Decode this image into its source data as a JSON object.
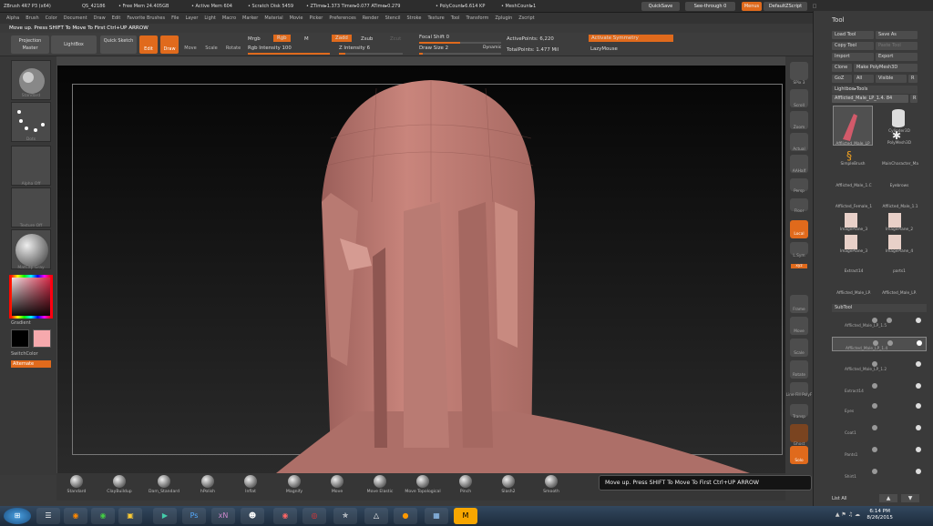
{
  "titlebar": {
    "app": "ZBrush 4R7 P3 (x64)",
    "qs": "QS_42186",
    "free_mem": "• Free Mem 24.405GB",
    "active_mem": "• Active Mem 604",
    "scratch": "• Scratch Disk 5459",
    "ztime": "• ZTime▸1.373 Timer▸0.077 ATime▸0.279",
    "polycount": "• PolyCount▸6.614 KP",
    "meshcount": "• MeshCount▸1",
    "quicksave": "QuickSave",
    "seethrough": "See-through 0",
    "menus": "Menus",
    "script": "DefaultZScript"
  },
  "menu": [
    "Alpha",
    "Brush",
    "Color",
    "Document",
    "Draw",
    "Edit",
    "Favorite Brushes",
    "File",
    "Layer",
    "Light",
    "Macro",
    "Marker",
    "Material",
    "Movie",
    "Picker",
    "Preferences",
    "Render",
    "Stencil",
    "Stroke",
    "Texture",
    "Tool",
    "Transform",
    "Zplugin",
    "Zscript"
  ],
  "hint": "Move up. Press SHIFT To Move To First Ctrl+UP ARROW",
  "shelf": {
    "projection": "Projection Master",
    "lightbox": "LightBox",
    "quicksketch": "Quick Sketch",
    "edit": "Edit",
    "draw": "Draw",
    "move": "Move",
    "scale": "Scale",
    "rotate": "Rotate",
    "mrgb": "Mrgb",
    "rgb": "Rgb",
    "m": "M",
    "zadd": "Zadd",
    "zsub": "Zsub",
    "zcut": "Zcut",
    "rgb_intensity": "Rgb Intensity 100",
    "z_intensity": "Z Intensity 6",
    "focal_shift": "Focal Shift 0",
    "draw_size": "Draw Size 2",
    "dynamic": "Dynamic",
    "active_points": "ActivePoints: 6,220",
    "total_points": "TotalPoints: 1.477 Mil",
    "activate_symmetry": "Activate Symmetry",
    "lazymouse": "LazyMouse"
  },
  "left": {
    "labels": [
      "Standard",
      "Dots",
      "Alpha Off",
      "Texture Off",
      "MatCap Gray"
    ],
    "gradient": "Gradient",
    "switchcolor": "SwitchColor",
    "alternate": "Alternate"
  },
  "right_strip": [
    "SPix 3",
    "Scroll",
    "Zoom",
    "Actual",
    "AAHalf",
    "Persp",
    "Floor",
    "Local",
    "L.Sym",
    "xyz",
    "Frame",
    "Move",
    "Scale",
    "Rotate",
    "Line Fill PolyF",
    "Transp",
    "Ghost",
    "Solo"
  ],
  "brushes": [
    "Standard",
    "ClayBuildup",
    "Dam_Standard",
    "hPolish",
    "Inflat",
    "Magnify",
    "Move",
    "Move Elastic",
    "Move Topological",
    "Pinch",
    "Slash2",
    "Smooth"
  ],
  "tooltip": "Move up. Press SHIFT To Move To First Ctrl+UP ARROW",
  "tool": {
    "title": "Tool",
    "buttons": [
      "Load Tool",
      "Save As",
      "Copy Tool",
      "Paste Tool",
      "Import",
      "Export",
      "Clone",
      "Make PolyMesh3D",
      "GoZ",
      "All",
      "Visible",
      "R"
    ],
    "lightbox_tools": "Lightbox▸Tools",
    "current": "Afflicted_Male_LP_1.4. 84",
    "current_r": "R",
    "grid": [
      "Afflicted_Male_LP",
      "Cylinder3D",
      "SimpleBrush",
      "PolyMesh3D",
      "MainCharacter_Ma",
      "Afflicted_Male_1.C",
      "Eyebrows",
      "Afflicted_Female_1",
      "Afflicted_Male_1.1",
      "ImagePlane_3",
      "ImagePlane_2",
      "ImagePlane_3",
      "ImagePlane_4",
      "Extract14",
      "parts1",
      "Afflicted_Male_LP.",
      "Afflicted_Male_LP."
    ],
    "subtool": "SubTool",
    "subtools": [
      "Afflicted_Male_LP_1.5",
      "Afflicted_Male_LP_1.4",
      "Afflicted_Male_LP_1.2",
      "Extract14",
      "Eyes",
      "Coat1",
      "Pants1",
      "Shirt1"
    ],
    "listall": "List All"
  },
  "clock": {
    "time": "6:14 PM",
    "date": "8/26/2015"
  }
}
